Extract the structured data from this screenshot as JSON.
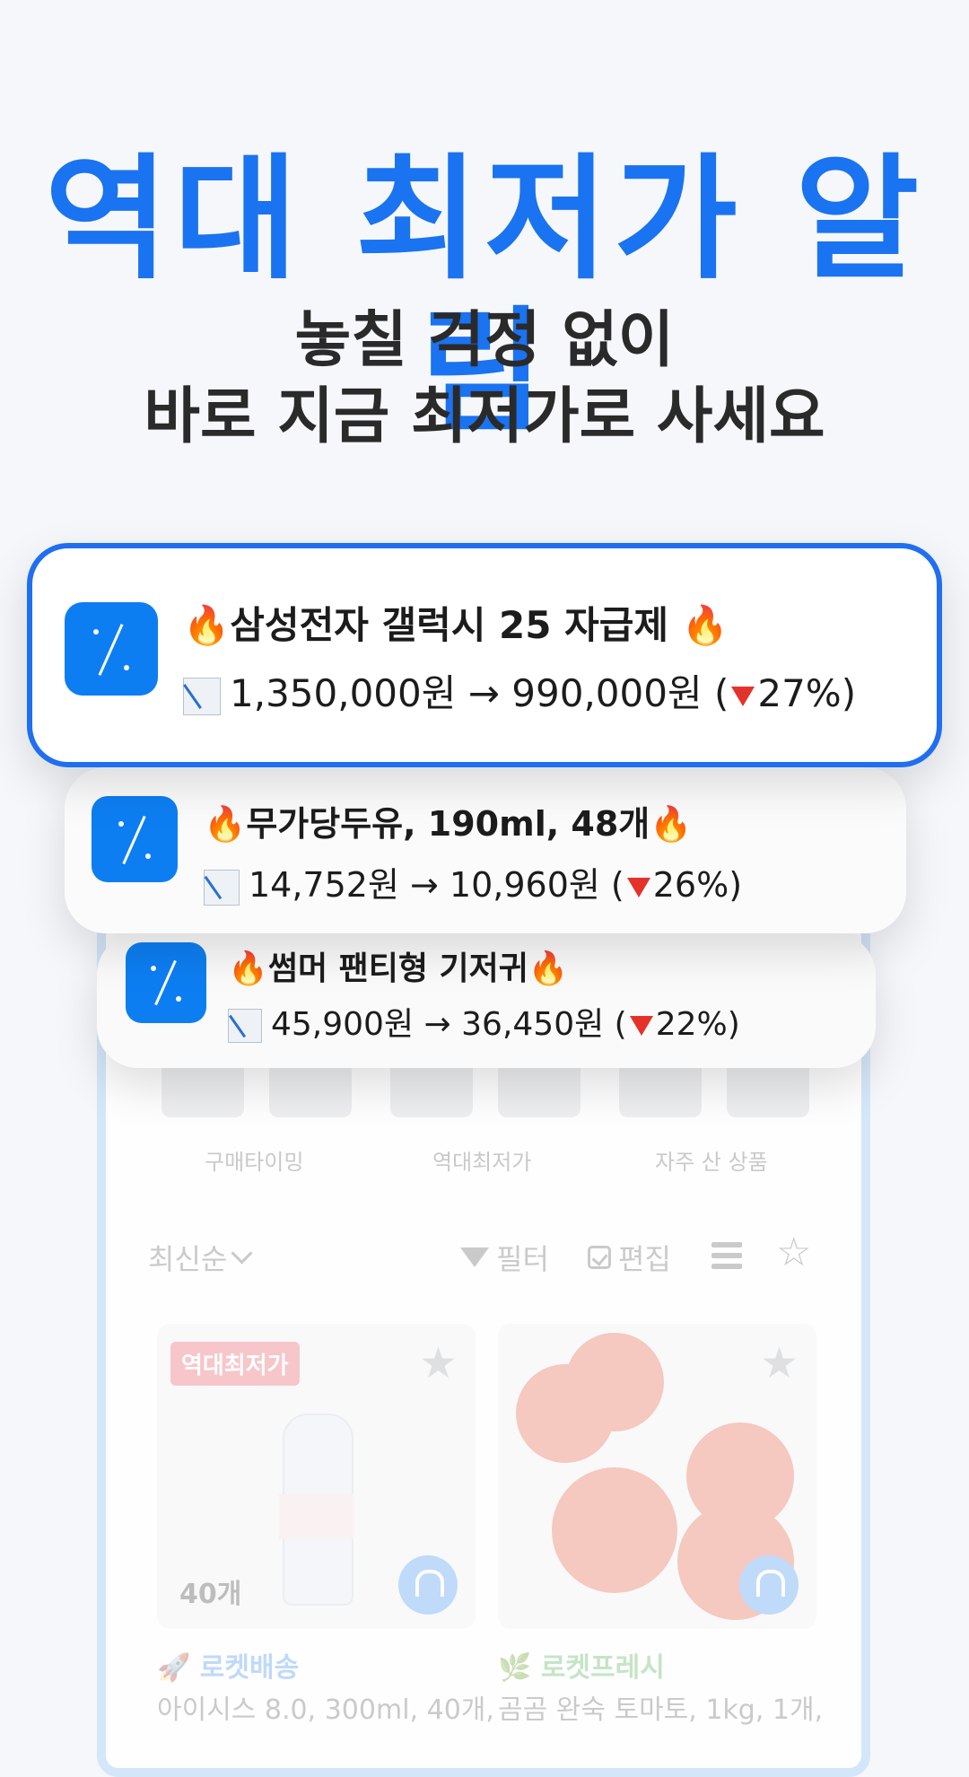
{
  "headline": "역대 최저가 알림",
  "subline_1": "놓칠 걱정 없이",
  "subline_2": "바로 지금 최저가로 사세요",
  "notifications": [
    {
      "title": "🔥삼성전자 갤럭시 25 자급제 🔥",
      "prefix": "1,350,000원 → 990,000원 (",
      "pct": "27%)"
    },
    {
      "title": "🔥무가당두유, 190ml, 48개🔥",
      "prefix": "14,752원 → 10,960원 (",
      "pct": "26%)"
    },
    {
      "title": "🔥썸머 팬티형 기저귀🔥",
      "prefix": "45,900원 → 36,450원 (",
      "pct": "22%)"
    }
  ],
  "categories": [
    "구매타이밍",
    "역대최저가",
    "자주 산 상품"
  ],
  "toolbar": {
    "sort": "최신순",
    "filter": "필터",
    "edit": "편집"
  },
  "products": [
    {
      "badge": "역대최저가",
      "count": "40개",
      "delivery": "🚀 로켓배송",
      "name": "아이시스 8.0, 300ml, 40개,"
    },
    {
      "delivery": "🌿 로켓프레시",
      "name": "곰곰 완숙 토마토, 1kg, 1개,"
    }
  ],
  "icons": {
    "app": "percent-app-icon",
    "trend": "chart-decreasing-icon",
    "down": "red-down-triangle-icon",
    "filter": "funnel-icon",
    "edit": "checkbox-icon",
    "list": "list-view-icon",
    "star": "star-icon",
    "bell": "bell-icon"
  },
  "colors": {
    "accent": "#1a73f0",
    "card_border": "#1f6ff0",
    "app_icon": "#0d7ef2",
    "down": "#e4322b"
  }
}
